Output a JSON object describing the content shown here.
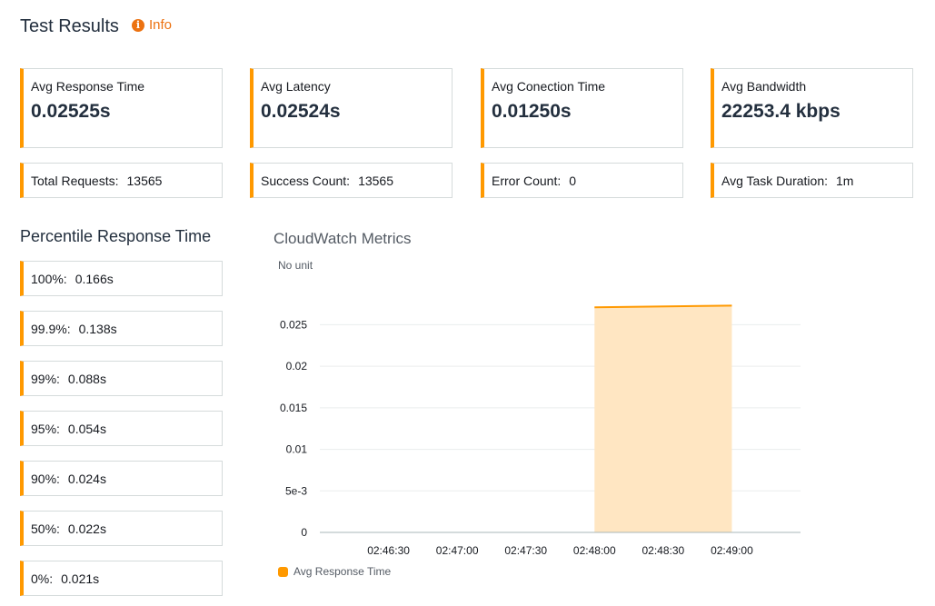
{
  "header": {
    "title": "Test Results",
    "info_label": "Info"
  },
  "metrics": [
    {
      "label": "Avg Response Time",
      "value": "0.02525s"
    },
    {
      "label": "Avg Latency",
      "value": "0.02524s"
    },
    {
      "label": "Avg Conection Time",
      "value": "0.01250s"
    },
    {
      "label": "Avg Bandwidth",
      "value": "22253.4 kbps"
    }
  ],
  "stats": [
    {
      "label": "Total Requests:",
      "value": "13565"
    },
    {
      "label": "Success Count:",
      "value": "13565"
    },
    {
      "label": "Error Count:",
      "value": "0"
    },
    {
      "label": "Avg Task Duration:",
      "value": "1m"
    }
  ],
  "percentiles": {
    "title": "Percentile Response Time",
    "items": [
      {
        "label": "100%:",
        "value": "0.166s"
      },
      {
        "label": "99.9%:",
        "value": "0.138s"
      },
      {
        "label": "99%:",
        "value": "0.088s"
      },
      {
        "label": "95%:",
        "value": "0.054s"
      },
      {
        "label": "90%:",
        "value": "0.024s"
      },
      {
        "label": "50%:",
        "value": "0.022s"
      },
      {
        "label": "0%:",
        "value": "0.021s"
      }
    ]
  },
  "chart_data": {
    "type": "area",
    "title": "CloudWatch Metrics",
    "ylabel": "No unit",
    "ylim": [
      0,
      0.028
    ],
    "yticks": [
      {
        "value": 0,
        "label": "0"
      },
      {
        "value": 0.005,
        "label": "5e-3"
      },
      {
        "value": 0.01,
        "label": "0.01"
      },
      {
        "value": 0.015,
        "label": "0.015"
      },
      {
        "value": 0.02,
        "label": "0.02"
      },
      {
        "value": 0.025,
        "label": "0.025"
      }
    ],
    "xlim": [
      "02:46:00",
      "02:49:30"
    ],
    "xticks": [
      "02:46:30",
      "02:47:00",
      "02:47:30",
      "02:48:00",
      "02:48:30",
      "02:49:00"
    ],
    "series": [
      {
        "name": "Avg Response Time",
        "color": "#ff9900",
        "fill": "#ffe6c2",
        "points": [
          {
            "x": "02:48:00",
            "y": 0.0271
          },
          {
            "x": "02:49:00",
            "y": 0.0273
          }
        ]
      }
    ],
    "grid": true,
    "legend": "bottom-left"
  }
}
